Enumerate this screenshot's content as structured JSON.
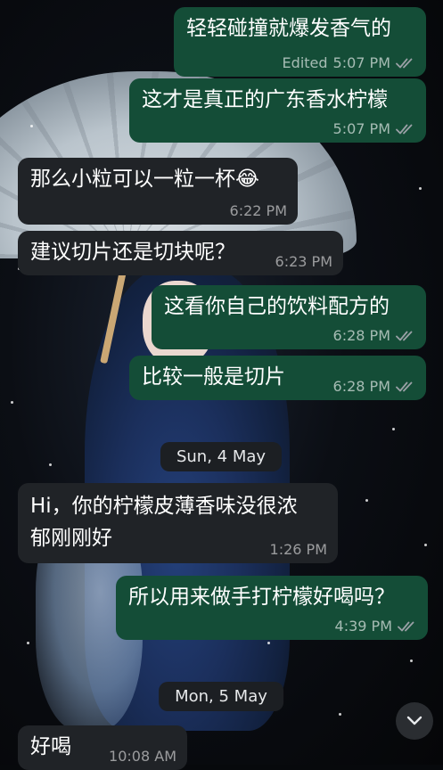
{
  "messages": [
    {
      "text": "轻轻碰撞就爆发香气的",
      "time": "5:07 PM",
      "edited": "Edited",
      "dir": "out"
    },
    {
      "text": "这才是真正的广东香水柠檬",
      "time": "5:07 PM",
      "dir": "out"
    },
    {
      "text": "那么小粒可以一粒一杯😂",
      "time": "6:22 PM",
      "dir": "in"
    },
    {
      "text": "建议切片还是切块呢？",
      "time": "6:23 PM",
      "dir": "in"
    },
    {
      "text": "这看你自己的饮料配方的",
      "time": "6:28 PM",
      "dir": "out"
    },
    {
      "text": "比较一般是切片",
      "time": "6:28 PM",
      "dir": "out"
    },
    {
      "text": "Hi，你的柠檬皮薄香味没很浓\n郁刚刚好",
      "time": "1:26 PM",
      "dir": "in"
    },
    {
      "text": "所以用来做手打柠檬好喝吗？",
      "time": "4:39 PM",
      "dir": "out"
    },
    {
      "text": "好喝",
      "time": "10:08 AM",
      "dir": "in"
    }
  ],
  "date_chips": [
    "Sun, 4 May",
    "Mon, 5 May"
  ],
  "icons": {
    "read_receipt": "double-check-icon",
    "scroll_down": "chevron-down-icon"
  },
  "colors": {
    "outgoing_bubble": "#144d37",
    "incoming_bubble": "#202327",
    "read_tick": "#9aa0a6"
  }
}
